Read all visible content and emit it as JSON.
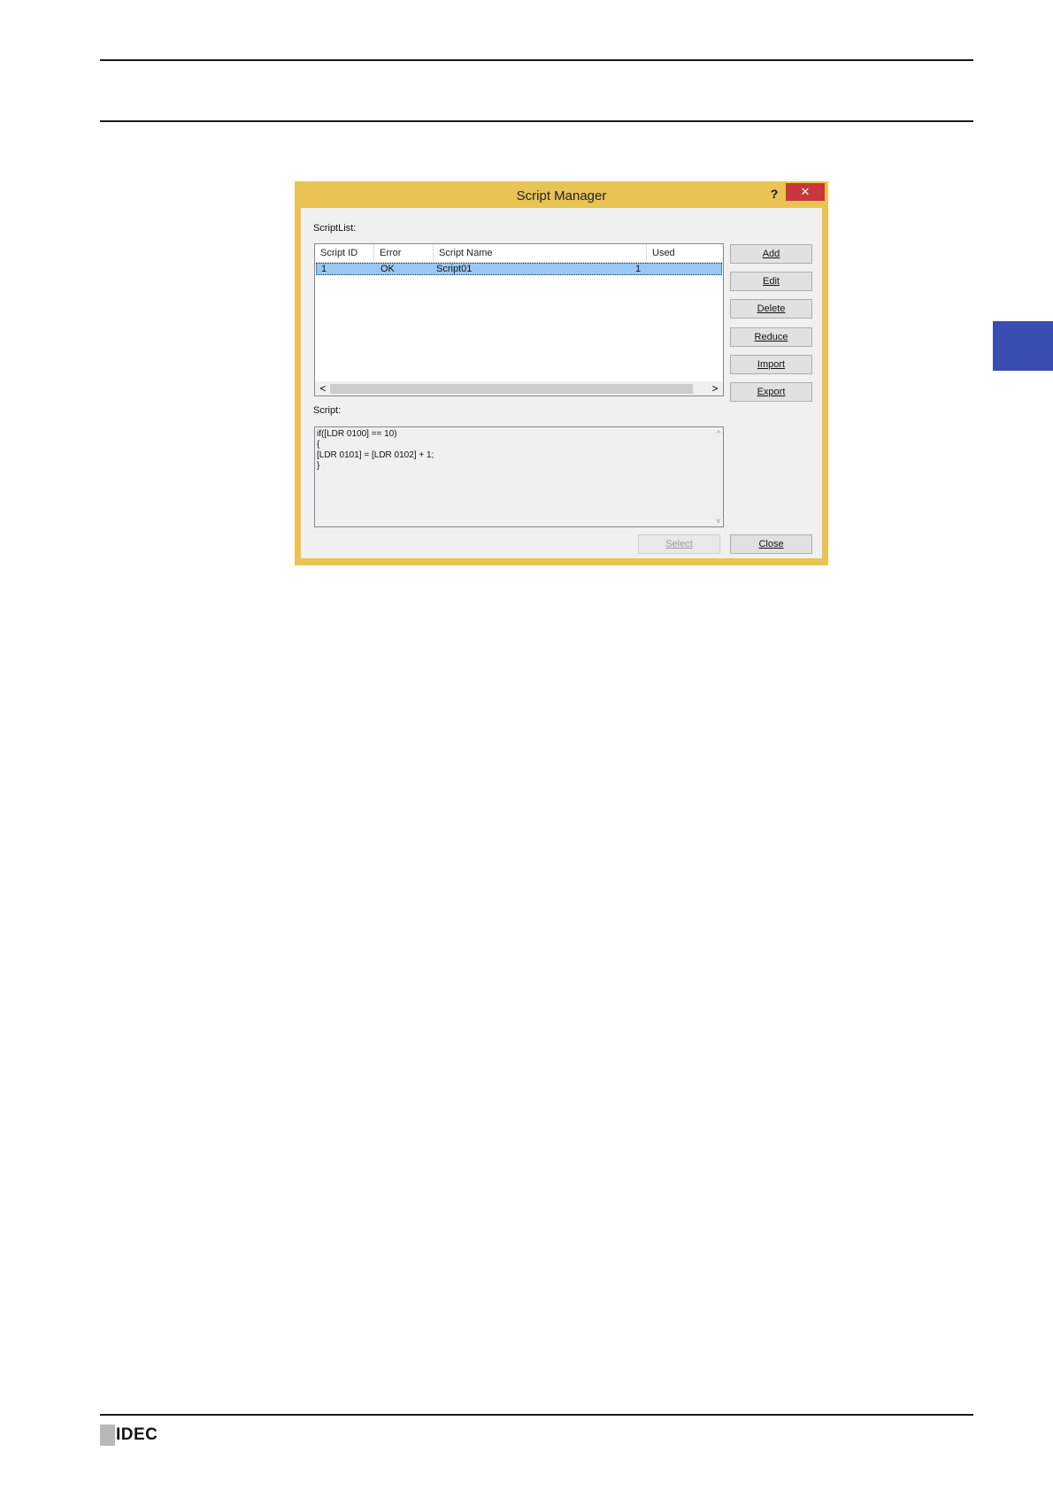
{
  "page": {
    "logo_text": "IDEC"
  },
  "dialog": {
    "title": "Script Manager",
    "help": "?",
    "close_glyph": "✕",
    "scriptlist_label": "ScriptList:",
    "columns": [
      "Script ID",
      "Error",
      "Script Name",
      "Used"
    ],
    "rows": [
      {
        "id": "1",
        "error": "OK",
        "name": "Script01",
        "used": "1"
      }
    ],
    "script_label": "Script:",
    "script_code": "if([LDR 0100] == 10)\n{\n[LDR 0101] = [LDR 0102] + 1;\n}",
    "buttons": {
      "add": "Add",
      "edit": "Edit",
      "delete": "Delete",
      "reduce": "Reduce",
      "import": "Import",
      "export": "Export",
      "select": "Select",
      "close": "Close"
    },
    "scroll_left": "<",
    "scroll_right": ">",
    "scroll_up": "^",
    "scroll_down": "v"
  },
  "colors": {
    "dialog_frame": "#e9c353",
    "close_button": "#c8373a",
    "selection": "#99c8f2",
    "side_tab": "#3a4db0"
  }
}
